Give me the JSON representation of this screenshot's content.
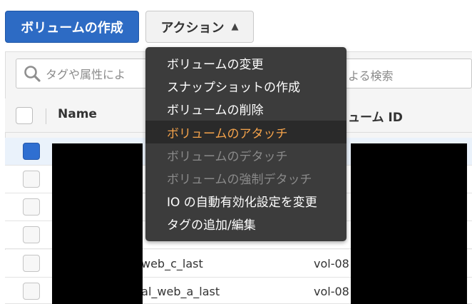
{
  "toolbar": {
    "create_volume_label": "ボリュームの作成",
    "actions_label": "アクション",
    "actions_chevron": "▲"
  },
  "search": {
    "placeholder_left": "タグや属性によ",
    "placeholder_right": "よる検索"
  },
  "table": {
    "columns": [
      "Name",
      "ューム ID"
    ],
    "rows": [
      {
        "name": "",
        "volume_id": "",
        "checked": true
      },
      {
        "name": "",
        "volume_id": "",
        "checked": false
      },
      {
        "name": "",
        "volume_id": "",
        "checked": false
      },
      {
        "name": "",
        "volume_id": "",
        "checked": false
      },
      {
        "name": "web_c_last",
        "volume_id": "vol-08",
        "checked": false
      },
      {
        "name": "pal_web_a_last",
        "volume_id": "vol-08",
        "checked": false
      }
    ]
  },
  "menu": {
    "items": [
      {
        "label": "ボリュームの変更",
        "state": "enabled"
      },
      {
        "label": "スナップショットの作成",
        "state": "enabled"
      },
      {
        "label": "ボリュームの削除",
        "state": "enabled"
      },
      {
        "label": "ボリュームのアタッチ",
        "state": "active"
      },
      {
        "label": "ボリュームのデタッチ",
        "state": "disabled"
      },
      {
        "label": "ボリュームの強制デタッチ",
        "state": "disabled"
      },
      {
        "label": "IO の自動有効化設定を変更",
        "state": "enabled"
      },
      {
        "label": "タグの追加/編集",
        "state": "enabled"
      }
    ]
  },
  "colors": {
    "primary": "#2d6bc4",
    "menu_bg": "#3c3c3c",
    "menu_active_text": "#f5a34b",
    "menu_disabled_text": "#8a8a8a"
  }
}
